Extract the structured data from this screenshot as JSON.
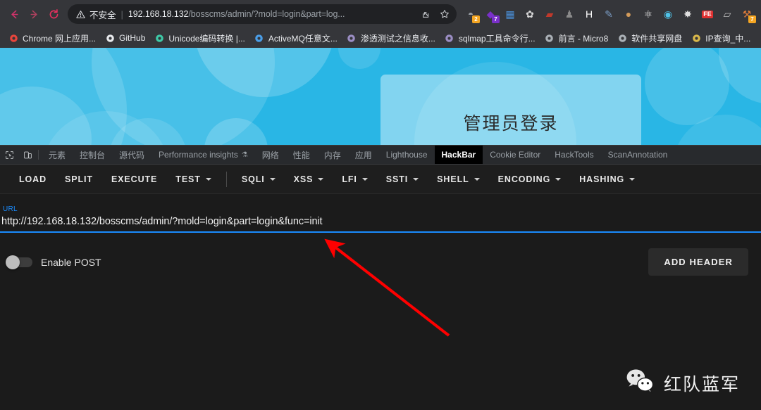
{
  "browser": {
    "nav": {
      "back": "back-arrow",
      "forward": "forward-arrow",
      "reload": "reload"
    },
    "omnibox": {
      "security_icon": "warning-triangle",
      "security_label": "不安全",
      "separator": "|",
      "url_host": "192.168.18.132",
      "url_path": "/bosscms/admin/?mold=login&part=log...",
      "share_icon": "share-icon",
      "bookmark_icon": "star-icon"
    },
    "extensions": [
      {
        "name": "proxy-switchyomega-extension",
        "glyph": "◓",
        "color": "#9aa0a6",
        "badge": "2",
        "badge_color": "#f5a623"
      },
      {
        "name": "violentmonkey-extension",
        "glyph": "◆",
        "color": "#7a30c9",
        "badge": "7",
        "badge_color": "#7a30c9"
      },
      {
        "name": "wappalyzer-extension",
        "glyph": "▦",
        "color": "#4a90d9",
        "badge": "",
        "badge_color": ""
      },
      {
        "name": "settings-gear-extension",
        "glyph": "✿",
        "color": "#d9d9d9",
        "badge": "",
        "badge_color": ""
      },
      {
        "name": "burp-proxy-extension",
        "glyph": "▰",
        "color": "#c0392b",
        "badge": "",
        "badge_color": ""
      },
      {
        "name": "user-agent-switcher-extension",
        "glyph": "♟",
        "color": "#8a8a8a",
        "badge": "",
        "badge_color": ""
      },
      {
        "name": "hacktools-extension",
        "glyph": "H",
        "color": "#ffffff",
        "badge": "",
        "badge_color": ""
      },
      {
        "name": "inspector-extension",
        "glyph": "✎",
        "color": "#7a9cc4",
        "badge": "",
        "badge_color": ""
      },
      {
        "name": "cookie-editor-extension",
        "glyph": "●",
        "color": "#d39b5a",
        "badge": "",
        "badge_color": ""
      },
      {
        "name": "molecule-extension",
        "glyph": "⚛",
        "color": "#e8e8e8",
        "badge": "",
        "badge_color": ""
      },
      {
        "name": "swimming-extension",
        "glyph": "◉",
        "color": "#4fc3e8",
        "badge": "",
        "badge_color": ""
      },
      {
        "name": "spider-extension",
        "glyph": "✸",
        "color": "#e0e0e0",
        "badge": "",
        "badge_color": ""
      },
      {
        "name": "fe-editor-extension",
        "glyph": "FE",
        "color": "#ffffff",
        "badge": "",
        "badge_color": ""
      },
      {
        "name": "blackhat-extension",
        "glyph": "▱",
        "color": "#b8b8b8",
        "badge": "",
        "badge_color": ""
      },
      {
        "name": "hackbar-extension",
        "glyph": "⚒",
        "color": "#e07b39",
        "badge": "7",
        "badge_color": "#f5a623"
      }
    ],
    "bookmarks": [
      {
        "label": "Chrome 网上应用...",
        "icon": "chrome-webstore-icon",
        "color": "#e8453c"
      },
      {
        "label": "GitHub",
        "icon": "github-icon",
        "color": "#e8eaed"
      },
      {
        "label": "Unicode编码转换 |...",
        "icon": "puzzle-icon",
        "color": "#3ec9a7"
      },
      {
        "label": "ActiveMQ任意文...",
        "icon": "flame-icon",
        "color": "#4a9ee8"
      },
      {
        "label": "渗透测试之信息收...",
        "icon": "anchor-icon",
        "color": "#9b8ec4"
      },
      {
        "label": "sqlmap工具命令行...",
        "icon": "anchor-icon",
        "color": "#9b8ec4"
      },
      {
        "label": "前言 - Micro8",
        "icon": "globe-icon",
        "color": "#aab0b6"
      },
      {
        "label": "软件共享网盘",
        "icon": "globe-icon",
        "color": "#aab0b6"
      },
      {
        "label": "IP查询_中...",
        "icon": "bczs-icon",
        "color": "#d9b84a"
      }
    ]
  },
  "page": {
    "login_title": "管理员登录",
    "background_color": "#29b6e5",
    "card_color": "rgba(255,255,255,0.42)"
  },
  "devtools": {
    "toolbar_icons": [
      {
        "name": "inspect-element-icon"
      },
      {
        "name": "device-toolbar-icon"
      }
    ],
    "tabs": [
      {
        "label": "元素",
        "active": false,
        "zh": true
      },
      {
        "label": "控制台",
        "active": false,
        "zh": true
      },
      {
        "label": "源代码",
        "active": false,
        "zh": true
      },
      {
        "label": "Performance insights",
        "active": false,
        "zh": false,
        "flask": "⚗"
      },
      {
        "label": "网络",
        "active": false,
        "zh": true
      },
      {
        "label": "性能",
        "active": false,
        "zh": true
      },
      {
        "label": "内存",
        "active": false,
        "zh": true
      },
      {
        "label": "应用",
        "active": false,
        "zh": true
      },
      {
        "label": "Lighthouse",
        "active": false,
        "zh": false
      },
      {
        "label": "HackBar",
        "active": true,
        "zh": false
      },
      {
        "label": "Cookie Editor",
        "active": false,
        "zh": false
      },
      {
        "label": "HackTools",
        "active": false,
        "zh": false
      },
      {
        "label": "ScanAnnotation",
        "active": false,
        "zh": false
      }
    ]
  },
  "hackbar": {
    "actions": [
      {
        "label": "LOAD",
        "dropdown": false
      },
      {
        "label": "SPLIT",
        "dropdown": false
      },
      {
        "label": "EXECUTE",
        "dropdown": false
      },
      {
        "label": "TEST",
        "dropdown": true
      }
    ],
    "payload_menus": [
      {
        "label": "SQLI",
        "dropdown": true
      },
      {
        "label": "XSS",
        "dropdown": true
      },
      {
        "label": "LFI",
        "dropdown": true
      },
      {
        "label": "SSTI",
        "dropdown": true
      },
      {
        "label": "SHELL",
        "dropdown": true
      },
      {
        "label": "ENCODING",
        "dropdown": true
      },
      {
        "label": "HASHING",
        "dropdown": true
      }
    ],
    "url_field": {
      "label": "URL",
      "value": "http://192.168.18.132/bosscms/admin/?mold=login&part=login&func=init",
      "accent_color": "#1a8cff"
    },
    "enable_post": {
      "label": "Enable POST",
      "state": "off"
    },
    "add_header_label": "ADD HEADER"
  },
  "annotation": {
    "arrow_color": "#ff0000",
    "arrow_from": "637,477",
    "arrow_to": "462,341"
  },
  "watermark": {
    "icon": "wechat-icon",
    "text": "红队蓝军"
  }
}
